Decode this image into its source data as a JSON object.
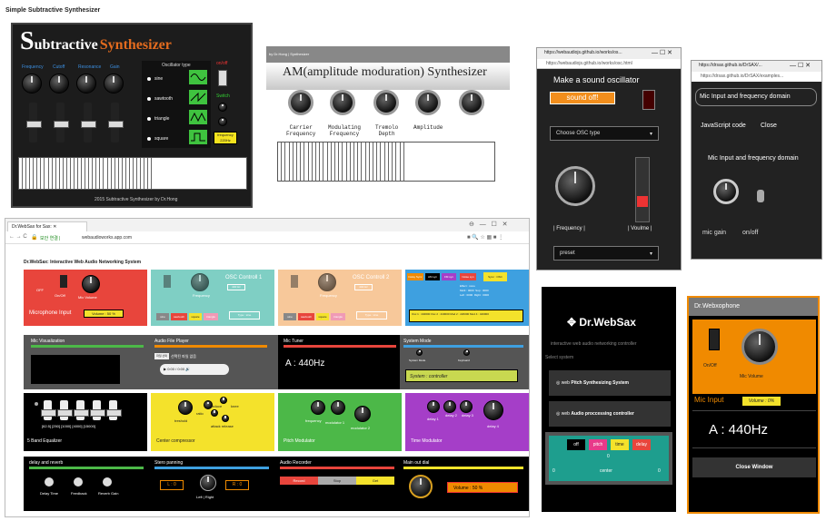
{
  "collage_title": "Simple Subtractive Synthesizer",
  "subtractive": {
    "title_s": "S",
    "title_ubtractive": "ubtractive",
    "title_synth": "Synthesizer",
    "knob_labels": [
      "Frequency",
      "Cutoff",
      "Resonance",
      "Gain"
    ],
    "osc_type_label": "Oscillator type",
    "osc_types": [
      "sine",
      "sawtooth",
      "triangle",
      "square"
    ],
    "onoff_label": "on/off",
    "switch_label": "Switch",
    "freq_badge_line1": "frequency",
    "freq_badge_line2": "220Hz",
    "footer": "2015 Subtractive Synthesizer  by  Dr.Hong"
  },
  "am": {
    "header": "by Dr.Hong  | Synthesizer",
    "title": "AM(amplitude moduration) Synthesizer",
    "knob_labels": [
      [
        "Carrier",
        "Frequency"
      ],
      [
        "Modulating",
        "Frequency"
      ],
      [
        "Tremolo",
        "Depth"
      ],
      [
        "Amplitude",
        ""
      ]
    ]
  },
  "osc_window": {
    "url_tab": "https://webaudiojs.github.io/works/os...",
    "url": "https://webaudiojs.github.io/works/osc.html",
    "title": "Make a sound oscillator",
    "sound_button": "sound off!",
    "select": "Choose OSC type",
    "freq_label": "| Frequency |",
    "vol_label": "| Voulme |",
    "preset": "preset"
  },
  "mic_window": {
    "url_tab": "https://drsax.github.io/DrSAX/...",
    "url": "https://drsax.github.io/DrSAX/examples...",
    "heading": "Mic Input and frequency domain",
    "link1": "JavaScript code",
    "link2": "Close",
    "subheading": "Mic Input and frequency domain",
    "knob_label": "mic gain",
    "toggle_label": "on/off"
  },
  "browser": {
    "tab_title": "Dr.WebSax for Sax:",
    "url": "webaudioworks.app.com",
    "url_prefix": "보안 연결 |",
    "page_title": "Dr.WebSax: Interactive Web Audio Networking System",
    "mic_panel": {
      "off": "OFF",
      "onoff": "On/Off",
      "vol": "Mic Volume",
      "title": "Microphone Input",
      "volume": "Volume : 50 %"
    },
    "osc1": {
      "title": "OSC Controll 1",
      "freq": "Frequency",
      "freq_badge": "440 Hz",
      "types": [
        "sine",
        "sawtooth",
        "square",
        "triangle"
      ],
      "type_badge": "Type : sine"
    },
    "osc2": {
      "title": "OSC Controll 2",
      "freq": "Frequency",
      "freq_badge": "440 Hz",
      "types": [
        "sine",
        "sawtooth",
        "square",
        "triangle"
      ],
      "type_badge": "Type : sine"
    },
    "effects": {
      "tabs": [
        "Delay Sync",
        "AM syn",
        "FM syn",
        "Noise syn"
      ],
      "sync": "Sync : OSC",
      "detail": "Effect : none\nMulti : 0000  Sup : 0000\nLeft : 0000  Right : 0000",
      "line": "Osc 1 : 440000   Osc 2 : 440000   Mod 2 : 220000   Mod 4 : 440000"
    },
    "visualization": "Mic Visualization",
    "player": {
      "title": "Audio File Player",
      "file_btn": "파일 선택",
      "file_label": "선택된 파일 없음",
      "time": "0:00 / 0:00"
    },
    "tuner": {
      "title": "Mic Tuner",
      "value": "A   :   440Hz"
    },
    "system": {
      "title": "System Mode",
      "left": "System Mode",
      "right": "Keyboard",
      "status": "System : controller"
    },
    "eq": {
      "bands": "[62.5]  [250]  [1000]  [4000]  [15000]",
      "title": "5 Band Equalizer"
    },
    "compressor": {
      "ratio": "ratio",
      "knee": "knee",
      "reduce": "reduce",
      "threshold": "treshold",
      "attack": "attack release",
      "title": "Center compressor"
    },
    "pitch": {
      "freq": "frequency",
      "mod1": "modulator 1",
      "mod2": "modulator 2",
      "title": "Pitch Modulator"
    },
    "time": {
      "delay1": "delay 1",
      "delay2": "delay 2",
      "delay3": "delay 3",
      "delay4": "delay 4",
      "title": "Time Modulator"
    },
    "delay": {
      "title": "delay and reverb",
      "labels": [
        "Delay Time",
        "Feedback",
        "Reverb Gain"
      ]
    },
    "pan": {
      "title": "Stero panning",
      "left": "L : 0",
      "right": "R : 0",
      "lr": "Left | Right"
    },
    "recorder": {
      "title": "Audio Recorder",
      "record": "Record",
      "stop": "Stop",
      "get": "Get"
    },
    "mainout": {
      "title": "Main out dial",
      "volume": "Volume : 50 %"
    }
  },
  "websax": {
    "title": "Dr.WebSax",
    "subtitle": "interactive web audio networking controller",
    "select": "Select system",
    "btn1_pre": "web",
    "btn1": "Pitch Synthesizing System",
    "btn2_pre": "web",
    "btn2": "Audio proccessing controller",
    "fx": [
      "off",
      "pitch",
      "time",
      "delay"
    ],
    "zero": "0",
    "left": "0",
    "center": "center",
    "right": "0"
  },
  "xophone": {
    "title": "Dr.Webxophone",
    "onoff": "On/Off",
    "micvol": "Mic Volume",
    "micinput": "Mic Input",
    "volume": "Volume : 0%",
    "tuner": "A   :   440Hz",
    "close": "Close Window"
  },
  "colors": {
    "red": "#e8453c",
    "teal": "#7fcfc4",
    "peach": "#f7c89a",
    "blue": "#3ea0e0",
    "yellow": "#f4e22b",
    "green": "#4cb848",
    "purple": "#a53ec8",
    "orange": "#f08a00"
  }
}
